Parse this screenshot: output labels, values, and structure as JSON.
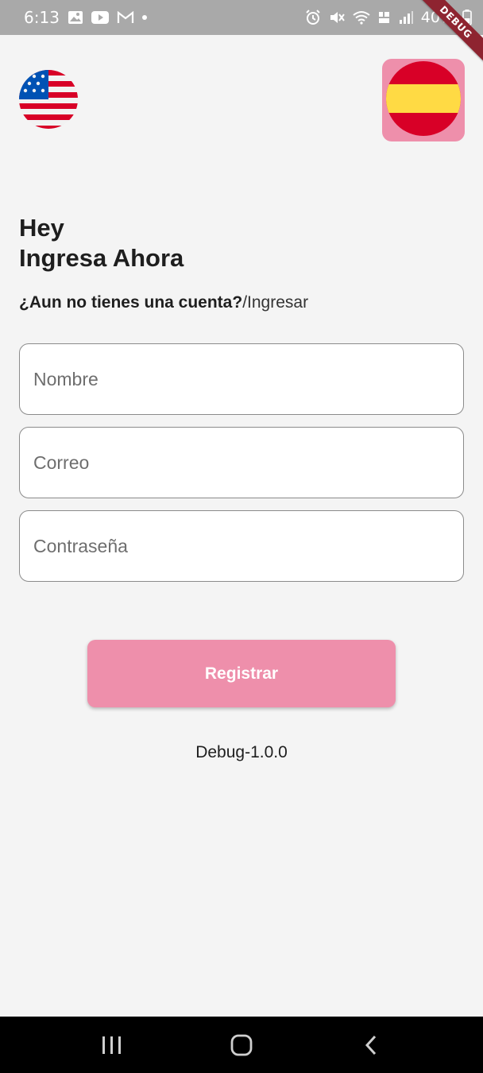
{
  "status_bar": {
    "time": "6:13",
    "battery": "40%",
    "left_icons": [
      "gallery-icon",
      "youtube-icon",
      "gmail-icon",
      "dot-icon"
    ],
    "right_icons": [
      "alarm-icon",
      "mute-icon",
      "wifi-icon",
      "volte-icon",
      "signal-icon",
      "battery-icon"
    ]
  },
  "debug_banner": "DEBUG",
  "language": {
    "left_flag": "us-flag-icon",
    "right_flag": "spain-flag-icon"
  },
  "header": {
    "line1": "Hey",
    "line2": "Ingresa Ahora"
  },
  "prompt": {
    "question": "¿Aun no tienes una cuenta?",
    "link": "/Ingresar"
  },
  "form": {
    "name_placeholder": "Nombre",
    "email_placeholder": "Correo",
    "password_placeholder": "Contraseña",
    "submit_label": "Registrar"
  },
  "version": "Debug-1.0.0",
  "colors": {
    "accent": "#ee8fab",
    "background": "#f4f4f4",
    "status_bar": "#a9a9a9",
    "debug_ribbon": "#8e2430"
  }
}
